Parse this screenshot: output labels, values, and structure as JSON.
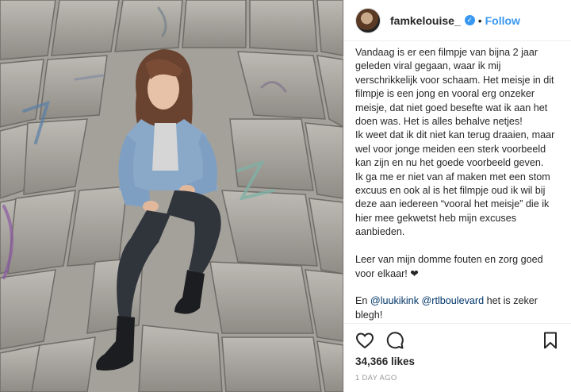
{
  "post": {
    "username": "famkelouise_",
    "verified_glyph": "✓",
    "separator": "•",
    "follow_label": "Follow",
    "caption_text": "Vandaag is er een filmpje van bijna 2 jaar geleden viral gegaan, waar ik mij verschrikkelijk voor schaam. Het meisje in dit filmpje is een jong en vooral erg onzeker meisje, dat niet goed besefte wat ik aan het doen was. Het is alles behalve netjes!\nIk weet dat ik dit niet kan terug draaien, maar wel voor jonge meiden een sterk voorbeeld kan zijn en nu het goede voorbeeld geven.\nIk ga me er niet van af maken met een stom excuus en ook al is het filmpje oud ik wil bij deze aan iedereen “vooral het meisje” die ik hier mee gekwetst heb mijn excuses aanbieden.\n\nLeer van mijn domme fouten en zorg goed voor elkaar! ❤",
    "mention_intro": "En ",
    "mention_1": "@luukikink",
    "mention_2": "@rtlboulevard",
    "mention_outro": " het is zeker blegh!",
    "likes": "34,366 likes",
    "time_ago": "1 DAY AGO"
  },
  "icons": {
    "like": "heart-icon",
    "comment": "comment-icon",
    "save": "bookmark-icon"
  },
  "colors": {
    "accent": "#3897f0",
    "mention": "#003569",
    "text": "#262626",
    "muted": "#999999"
  }
}
